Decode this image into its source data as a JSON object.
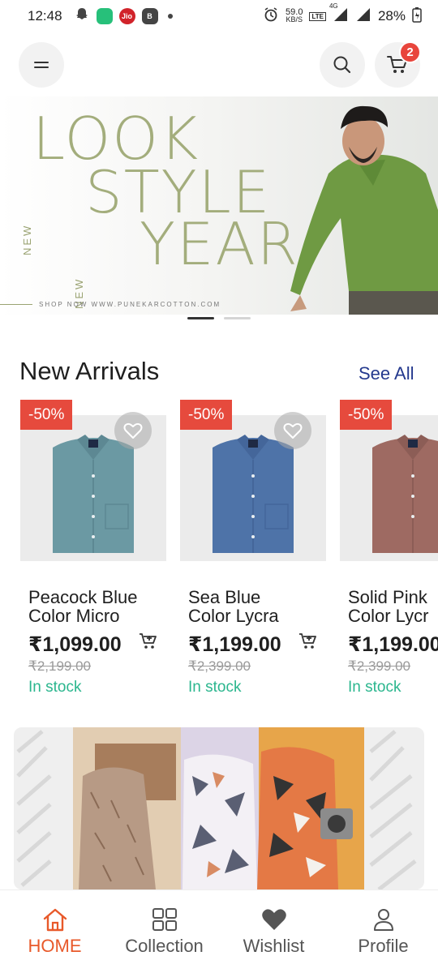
{
  "status_bar": {
    "time": "12:48",
    "net_speed_value": "59.0",
    "net_speed_unit": "KB/S",
    "lte_label": "LTE",
    "network_type": "4G",
    "battery_percent": "28%",
    "apps": [
      {
        "name": "snapchat-icon",
        "color": "#555555"
      },
      {
        "name": "chat-app-icon",
        "color": "#27c07a"
      },
      {
        "name": "jio-icon",
        "color": "#d1232a",
        "text": "Jio"
      },
      {
        "name": "b-app-icon",
        "color": "#444444",
        "text": "B"
      }
    ]
  },
  "header": {
    "cart_count": "2"
  },
  "banner": {
    "new_label": "NEW",
    "line1": "LOOK",
    "line2": "STYLE",
    "line3": "YEAR",
    "tagline": "SHOP NOW WWW.PUNEKARCOTTON.COM",
    "active_slide": 1,
    "slide_count": 2
  },
  "section": {
    "title": "New Arrivals",
    "see_all": "See All"
  },
  "products": [
    {
      "discount": "-50%",
      "name_line1": "Peacock Blue",
      "name_line2": "Color Micro",
      "price": "₹1,099.00",
      "old_price": "₹2,199.00",
      "stock": "In stock",
      "shirt_color": "#6b99a3"
    },
    {
      "discount": "-50%",
      "name_line1": "Sea Blue",
      "name_line2": "Color Lycra",
      "price": "₹1,199.00",
      "old_price": "₹2,399.00",
      "stock": "In stock",
      "shirt_color": "#4e73a8"
    },
    {
      "discount": "-50%",
      "name_line1": "Solid Pink",
      "name_line2": "Color Lycr",
      "price": "₹1,199.00",
      "old_price": "₹2,399.00",
      "stock": "In stock",
      "shirt_color": "#9e6a62"
    }
  ],
  "bottom_nav": [
    {
      "label": "HOME",
      "icon": "home-icon",
      "active": true
    },
    {
      "label": "Collection",
      "icon": "grid-icon",
      "active": false
    },
    {
      "label": "Wishlist",
      "icon": "heart-icon",
      "active": false
    },
    {
      "label": "Profile",
      "icon": "person-icon",
      "active": false
    }
  ],
  "colors": {
    "accent": "#e8592a",
    "badge": "#e8453c",
    "discount": "#e64a3d",
    "stock": "#2bb68e",
    "link": "#24398e",
    "banner_text": "#a3ad7c"
  }
}
